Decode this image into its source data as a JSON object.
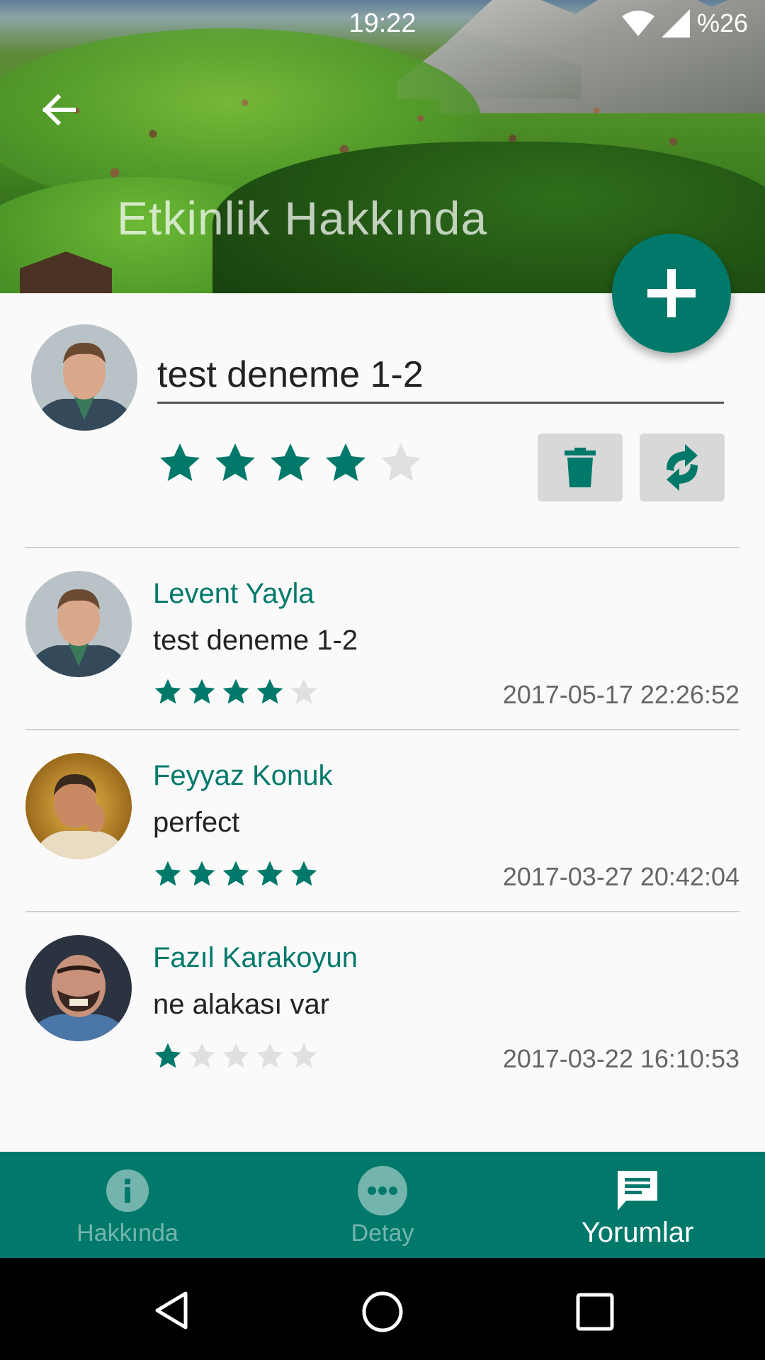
{
  "status_bar": {
    "time": "19:22",
    "battery": "%26",
    "icons": [
      "wifi-icon",
      "signal-icon"
    ]
  },
  "header": {
    "title": "Etkinlik Hakkında",
    "back_icon": "arrow-back-icon"
  },
  "fab": {
    "icon": "plus-icon"
  },
  "composer": {
    "input_value": "test deneme 1-2",
    "rating": 4,
    "max_rating": 5,
    "delete_icon": "trash-icon",
    "refresh_icon": "refresh-icon"
  },
  "comments": [
    {
      "author": "Levent Yayla",
      "text": "test deneme 1-2",
      "rating": 4,
      "date": "2017-05-17 22:26:52"
    },
    {
      "author": "Feyyaz Konuk",
      "text": "perfect",
      "rating": 5,
      "date": "2017-03-27 20:42:04"
    },
    {
      "author": "Fazıl Karakoyun",
      "text": "ne alakası var",
      "rating": 1,
      "date": "2017-03-22 16:10:53"
    }
  ],
  "bottom_nav": {
    "items": [
      {
        "label": "Hakkında",
        "icon": "info-icon",
        "active": false
      },
      {
        "label": "Detay",
        "icon": "more-dots-icon",
        "active": false
      },
      {
        "label": "Yorumlar",
        "icon": "comment-icon",
        "active": true
      }
    ]
  },
  "colors": {
    "accent": "#00796b",
    "star_empty": "#e0e0e0",
    "divider": "#d0d0d0"
  }
}
